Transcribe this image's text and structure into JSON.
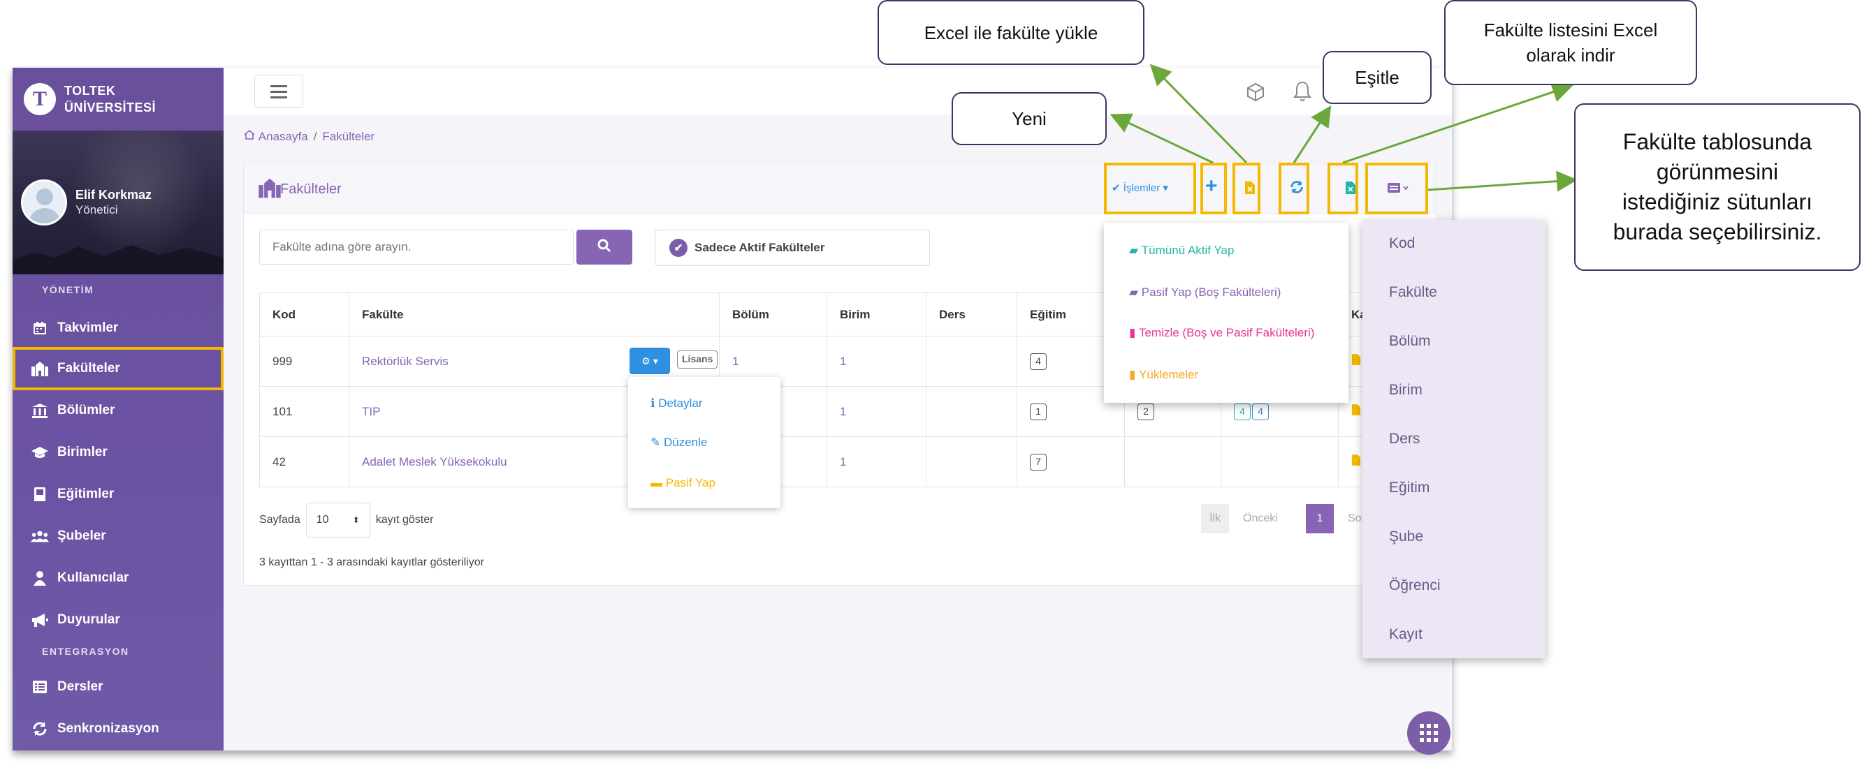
{
  "app": {
    "logo_letter": "T",
    "name_line1": "TOLTEK",
    "name_line2": "ÜNİVERSİTESİ"
  },
  "user": {
    "name": "Elif Korkmaz",
    "role": "Yönetici"
  },
  "sidebar": {
    "section1": "YÖNETİM",
    "section2": "ENTEGRASYON",
    "items": [
      {
        "label": "Takvimler",
        "icon": "calendar-icon"
      },
      {
        "label": "Fakülteler",
        "icon": "university-icon",
        "active": true
      },
      {
        "label": "Bölümler",
        "icon": "institution-icon"
      },
      {
        "label": "Birimler",
        "icon": "graduation-cap-icon"
      },
      {
        "label": "Eğitimler",
        "icon": "book-icon"
      },
      {
        "label": "Şubeler",
        "icon": "users-icon"
      },
      {
        "label": "Kullanıcılar",
        "icon": "user-icon"
      },
      {
        "label": "Duyurular",
        "icon": "bullhorn-icon"
      },
      {
        "label": "Dersler",
        "icon": "list-icon"
      },
      {
        "label": "Senkronizasyon",
        "icon": "sync-icon"
      }
    ]
  },
  "breadcrumb": {
    "home": "Anasayfa",
    "current": "Fakülteler"
  },
  "card": {
    "title": "Fakülteler"
  },
  "toolbar": {
    "actions_label": "İşlemler"
  },
  "search": {
    "placeholder": "Fakülte adına göre arayın.",
    "filter_label": "Sadece Aktif Fakülteler"
  },
  "table": {
    "headers": [
      "Kod",
      "Fakülte",
      "Bölüm",
      "Birim",
      "Ders",
      "Eğitim",
      "",
      "",
      "Ka"
    ],
    "rows": [
      {
        "kod": "999",
        "fakulte": "Rektörlük Servis",
        "tag": "Lisans",
        "bolum": "1",
        "birim": "1",
        "ders": "",
        "egitim": "4",
        "sube": "",
        "ogrenci": ""
      },
      {
        "kod": "101",
        "fakulte": "TIP",
        "tag": "",
        "bolum": "",
        "birim": "1",
        "ders": "",
        "egitim": "1",
        "sube": "2",
        "ogrenci": "4|4"
      },
      {
        "kod": "42",
        "fakulte": "Adalet Meslek Yüksekokulu",
        "tag": "",
        "bolum": "",
        "birim": "1",
        "ders": "",
        "egitim": "7",
        "sube": "",
        "ogrenci": ""
      }
    ]
  },
  "row_menu": {
    "details": "Detaylar",
    "edit": "Düzenle",
    "deactivate": "Pasif Yap"
  },
  "actions_menu": {
    "all_active": "Tümünü Aktif Yap",
    "make_passive": "Pasif Yap (Boş Fakülteleri)",
    "clean": "Temizle (Boş ve Pasif Fakülteleri)",
    "uploads": "Yüklemeler"
  },
  "column_menu": [
    "Kod",
    "Fakülte",
    "Bölüm",
    "Birim",
    "Ders",
    "Eğitim",
    "Şube",
    "Öğrenci",
    "Kayıt"
  ],
  "pagination": {
    "per_page_label": "Sayfada",
    "per_page_value": "10",
    "per_page_suffix": "kayıt göster",
    "first": "İlk",
    "prev": "Önceki",
    "current": "1",
    "next": "Sonra"
  },
  "footer_info": "3 kayıttan 1 - 3 arasındaki kayıtlar gösteriliyor",
  "callouts": {
    "upload": "Excel ile fakülte yükle",
    "new": "Yeni",
    "sync": "Eşitle",
    "export_line1": "Fakülte listesini Excel",
    "export_line2": "olarak indir",
    "columns_line1": "Fakülte tablosunda",
    "columns_line2": "görünmesini",
    "columns_line3": "istediğiniz sütunları",
    "columns_line4": "burada seçebilirsiniz."
  },
  "colors": {
    "primary": "#8565b4",
    "sidebar": "#6a4f9c",
    "highlight": "#f5b800",
    "arrow": "#6aa83a",
    "teal": "#1fb5a8",
    "pink": "#e8368f",
    "orange": "#f5a623"
  }
}
